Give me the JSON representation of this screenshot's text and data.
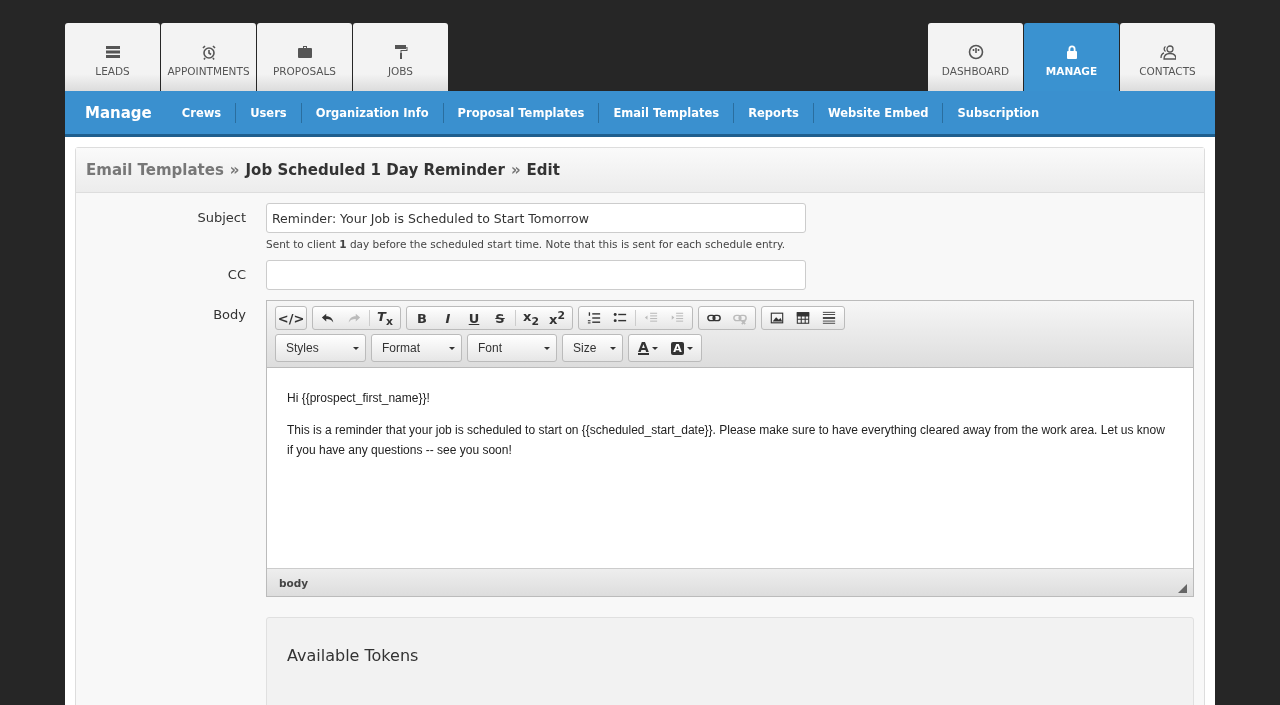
{
  "tabs_left": [
    {
      "label": "LEADS",
      "kind": "list",
      "selected": false
    },
    {
      "label": "APPOINTMENTS",
      "kind": "alarm",
      "selected": false
    },
    {
      "label": "PROPOSALS",
      "kind": "briefcase",
      "selected": false
    },
    {
      "label": "JOBS",
      "kind": "roller",
      "selected": false
    }
  ],
  "tabs_right": [
    {
      "label": "DASHBOARD",
      "kind": "gauge",
      "selected": false
    },
    {
      "label": "MANAGE",
      "kind": "lock",
      "selected": true
    },
    {
      "label": "CONTACTS",
      "kind": "people",
      "selected": false
    }
  ],
  "subnav": {
    "title": "Manage",
    "items": [
      "Crews",
      "Users",
      "Organization Info",
      "Proposal Templates",
      "Email Templates",
      "Reports",
      "Website Embed",
      "Subscription"
    ]
  },
  "breadcrumb": {
    "link": "Email Templates",
    "separator": "»",
    "items": [
      "Job Scheduled 1 Day Reminder",
      "Edit"
    ]
  },
  "form": {
    "subject": {
      "label": "Subject",
      "value": "Reminder: Your Job is Scheduled to Start Tomorrow",
      "help": "Sent to client **1** day before the scheduled start time. Note that this is sent for each schedule entry."
    },
    "cc": {
      "label": "CC"
    },
    "body": {
      "label": "Body"
    }
  },
  "editor": {
    "toolbar_groups": [
      [
        {
          "kind": "glyph",
          "glyph": "</>",
          "disabled": false
        }
      ],
      [
        {
          "kind": "undo",
          "disabled": false
        },
        {
          "kind": "redo",
          "disabled": true
        },
        {
          "kind": "glyph",
          "glyph": "*T*$_{x}$",
          "disabled": false
        }
      ],
      [
        {
          "kind": "glyph",
          "glyph": "**B**",
          "disabled": false
        },
        {
          "kind": "glyph",
          "glyph": "*I*",
          "disabled": false
        },
        {
          "kind": "underline",
          "glyph": "U",
          "disabled": false
        },
        {
          "kind": "strike",
          "glyph": "S",
          "disabled": false
        },
        {
          "kind": "glyph",
          "glyph": "x$_{2}$",
          "disabled": false
        },
        {
          "kind": "glyph",
          "glyph": "x$^{2}$",
          "disabled": false
        }
      ],
      [
        {
          "kind": "ol",
          "disabled": false
        },
        {
          "kind": "ul",
          "disabled": false
        },
        {
          "kind": "outdent",
          "disabled": true
        },
        {
          "kind": "indent",
          "disabled": true
        }
      ],
      [
        {
          "kind": "link",
          "disabled": false
        },
        {
          "kind": "unlink",
          "disabled": true
        }
      ],
      [
        {
          "kind": "image",
          "disabled": false
        },
        {
          "kind": "table",
          "disabled": false
        },
        {
          "kind": "hr",
          "disabled": false
        }
      ]
    ],
    "dropdowns": [
      "Styles",
      "Format",
      "Font",
      "Size"
    ],
    "color_buttons": [
      {
        "kind": "text",
        "glyph": "A"
      },
      {
        "kind": "background",
        "glyph": "A"
      }
    ],
    "content": [
      "Hi {{prospect_first_name}}!",
      "This is a reminder that your job is scheduled to start on {{scheduled_start_date}}.  Please make sure to have everything cleared away from the work area.  Let us know if you have any questions -- see you soon!"
    ],
    "status": "body"
  },
  "tokens": {
    "title": "Available Tokens"
  }
}
